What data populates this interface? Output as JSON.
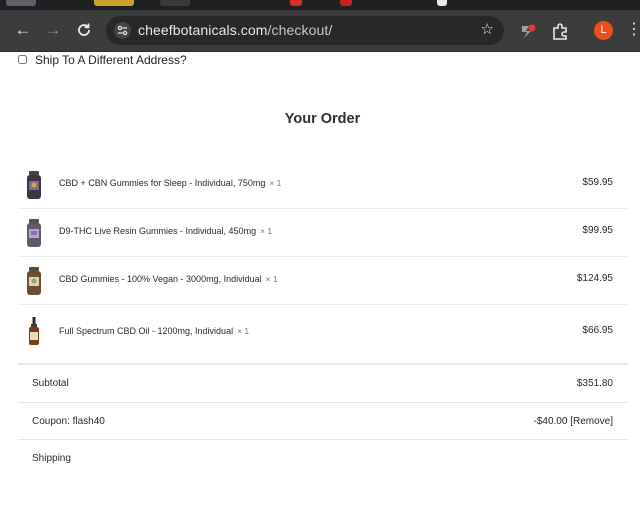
{
  "browser": {
    "url_host": "cheefbotanicals.com",
    "url_path": "/checkout/",
    "profile_initial": "L",
    "colors": {
      "toolbar": "#3c3c3c",
      "omnibox": "#282828",
      "avatar": "#e8501e"
    }
  },
  "checkout": {
    "ship_different_label": "Ship To A Different Address?",
    "order_title": "Your Order",
    "items": [
      {
        "name": "CBD + CBN Gummies for Sleep - Individual, 750mg",
        "qty": "× 1",
        "price": "$59.95",
        "icon": "gummy-jar-dark"
      },
      {
        "name": "D9-THC Live Resin Gummies - Individual, 450mg",
        "qty": "× 1",
        "price": "$99.95",
        "icon": "gummy-jar-purple"
      },
      {
        "name": "CBD Gummies - 100% Vegan - 3000mg, Individual",
        "qty": "× 1",
        "price": "$124.95",
        "icon": "gummy-jar-amber"
      },
      {
        "name": "Full Spectrum CBD Oil - 1200mg, Individual",
        "qty": "× 1",
        "price": "$66.95",
        "icon": "tincture-bottle"
      }
    ],
    "subtotal_label": "Subtotal",
    "subtotal_value": "$351.80",
    "coupon_label": "Coupon: flash40",
    "coupon_value": "-$40.00",
    "coupon_remove": "[Remove]",
    "shipping_label": "Shipping"
  }
}
